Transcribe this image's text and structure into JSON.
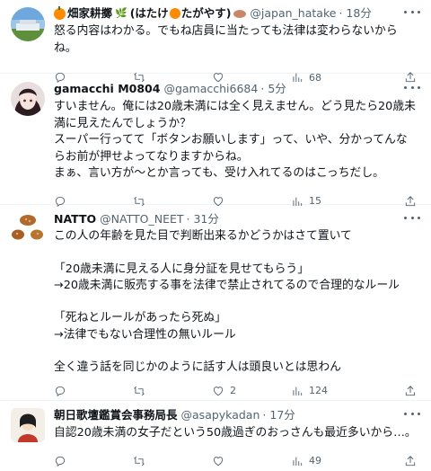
{
  "tweets": [
    {
      "name_prefix": "",
      "name": "畑家耕擲",
      "name_suffix": "(はたけ",
      "name_suffix2": "たがやす)",
      "handle": "@japan_hatake",
      "sep": "·",
      "time": "18分",
      "text": "怒る内容はわかる。でもね店員に当たっても法律は変わらないからね。",
      "replies": "",
      "retweets": "",
      "likes": "68"
    },
    {
      "name": "gamacchi M0804",
      "handle": "@gamacchi6684",
      "sep": "·",
      "time": "5分",
      "text": "すいません。俺には20歳未満には全く見えません。どう見たら20歳未満に見えたんでしょうか？\nスーパー行ってて「ボタンお願いします」って、いや、分かってんならお前が押せよってなりますからね。\nまぁ、言い方が～とか言っても、受け入れてるのはこっちだし。",
      "replies": "",
      "retweets": "",
      "likes": "15"
    },
    {
      "name": "NATTO",
      "handle": "@NATTO_NEET",
      "sep": "·",
      "time": "31分",
      "text": "この人の年齢を見た目で判断出来るかどうかはさて置いて\n\n「20歳未満に見える人に身分証を見せてもらう」\n→20歳未満に販売する事を法律で禁止されてるので合理的なルール\n\n「死ねとルールがあったら死ぬ」\n→法律でもない合理性の無いルール\n\n全く違う話を同じかのように話す人は頭良いとは思わん",
      "replies": "",
      "retweets": "2",
      "likes": "124"
    },
    {
      "name": "朝日歌壇鑑賞会事務局長",
      "handle": "@asapykadan",
      "sep": "·",
      "time": "17分",
      "text": "自認20歳未満の女子だという50歳過ぎのおっさんも最近多いから…。",
      "replies": "",
      "retweets": "",
      "likes": "49"
    }
  ],
  "icons": {
    "reply": "reply-icon",
    "retweet": "retweet-icon",
    "like": "heart-icon",
    "views": "views-icon",
    "share": "share-icon",
    "more": "more-icon"
  },
  "colors": {
    "text": "#0f1419",
    "secondary": "#536471",
    "divider": "#eff3f4",
    "orange": "#ff8a00"
  }
}
